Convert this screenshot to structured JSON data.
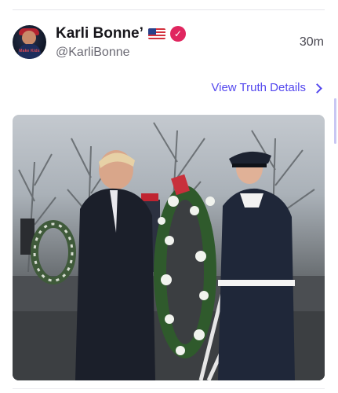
{
  "post": {
    "author": {
      "display_name": "Karli Bonne’",
      "handle": "@KarliBonne",
      "avatar_text": "Make Kids"
    },
    "time_ago": "30m",
    "view_details_label": "View Truth Details",
    "icons": {
      "flag": "us-flag-icon",
      "verified": "verified-badge-icon",
      "chevron": "chevron-right-icon"
    }
  },
  "colors": {
    "accent": "#5448ee",
    "verified_badge": "#e0265f",
    "name_text": "#17161b",
    "secondary_text": "#6a6973"
  }
}
